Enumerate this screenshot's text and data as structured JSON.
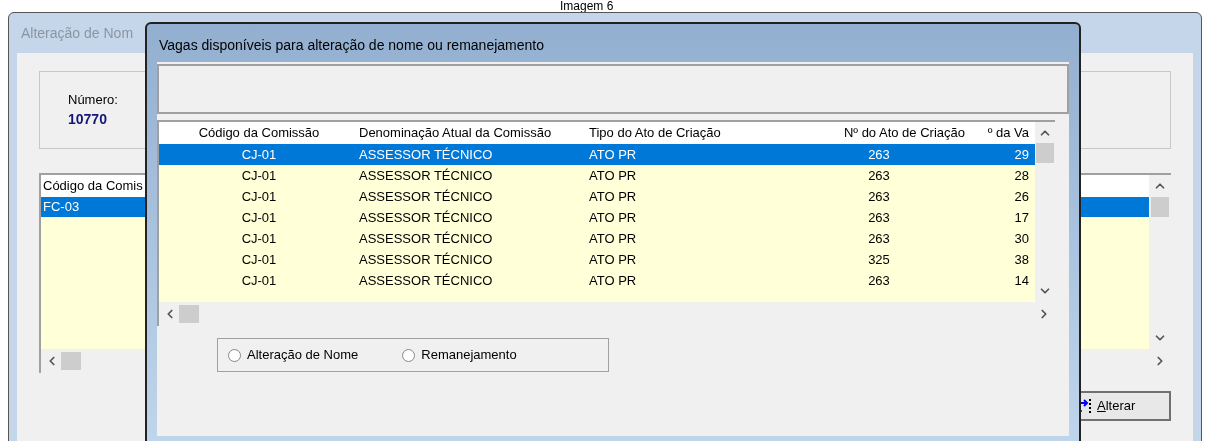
{
  "caption": "Imagem 6",
  "main_window": {
    "title": "Alteração de Nom",
    "number_label": "Número:",
    "number_value": "10770",
    "list": {
      "columns": [
        "Código da Comis"
      ],
      "rows": [
        {
          "cells": [
            "FC-03"
          ],
          "selected": true
        }
      ]
    },
    "button": "Alterar"
  },
  "dialog": {
    "title": "Vagas disponíveis para alteração de nome ou remanejamento",
    "table": {
      "columns": [
        "Código da Comissão",
        "Denominação Atual da Comissão",
        "Tipo do Ato de Criação",
        "Nº do Ato de Criação",
        "º da Va"
      ],
      "rows": [
        {
          "cells": [
            "CJ-01",
            "ASSESSOR TÉCNICO",
            "ATO PR",
            "263",
            "29"
          ],
          "selected": true
        },
        {
          "cells": [
            "CJ-01",
            "ASSESSOR TÉCNICO",
            "ATO PR",
            "263",
            "28"
          ],
          "selected": false
        },
        {
          "cells": [
            "CJ-01",
            "ASSESSOR TÉCNICO",
            "ATO PR",
            "263",
            "26"
          ],
          "selected": false
        },
        {
          "cells": [
            "CJ-01",
            "ASSESSOR TÉCNICO",
            "ATO PR",
            "263",
            "17"
          ],
          "selected": false
        },
        {
          "cells": [
            "CJ-01",
            "ASSESSOR TÉCNICO",
            "ATO PR",
            "263",
            "30"
          ],
          "selected": false
        },
        {
          "cells": [
            "CJ-01",
            "ASSESSOR TÉCNICO",
            "ATO PR",
            "325",
            "38"
          ],
          "selected": false
        },
        {
          "cells": [
            "CJ-01",
            "ASSESSOR TÉCNICO",
            "ATO PR",
            "263",
            "14"
          ],
          "selected": false
        }
      ]
    },
    "options": [
      {
        "label": "Alteração de Nome",
        "selected": false
      },
      {
        "label": "Remanejamento",
        "selected": false
      }
    ]
  }
}
